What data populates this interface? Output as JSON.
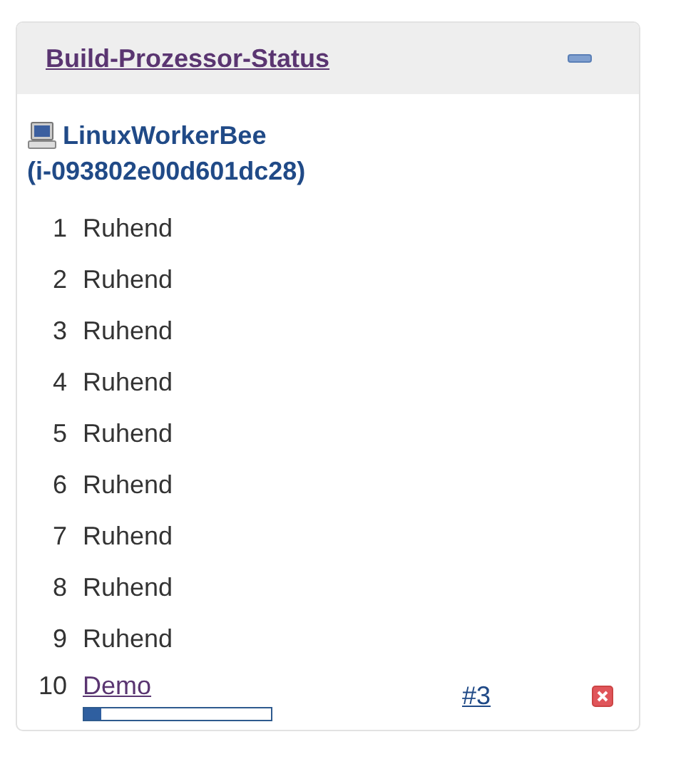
{
  "panel": {
    "title": "Build-Prozessor-Status"
  },
  "computer": {
    "name": "LinuxWorkerBee",
    "instance": "(i-093802e00d601dc28)"
  },
  "executors": [
    {
      "number": "1",
      "kind": "idle",
      "status": "Ruhend"
    },
    {
      "number": "2",
      "kind": "idle",
      "status": "Ruhend"
    },
    {
      "number": "3",
      "kind": "idle",
      "status": "Ruhend"
    },
    {
      "number": "4",
      "kind": "idle",
      "status": "Ruhend"
    },
    {
      "number": "5",
      "kind": "idle",
      "status": "Ruhend"
    },
    {
      "number": "6",
      "kind": "idle",
      "status": "Ruhend"
    },
    {
      "number": "7",
      "kind": "idle",
      "status": "Ruhend"
    },
    {
      "number": "8",
      "kind": "idle",
      "status": "Ruhend"
    },
    {
      "number": "9",
      "kind": "idle",
      "status": "Ruhend"
    },
    {
      "number": "10",
      "kind": "build",
      "job": "Demo",
      "build": "#3",
      "level": 0.09
    }
  ]
}
